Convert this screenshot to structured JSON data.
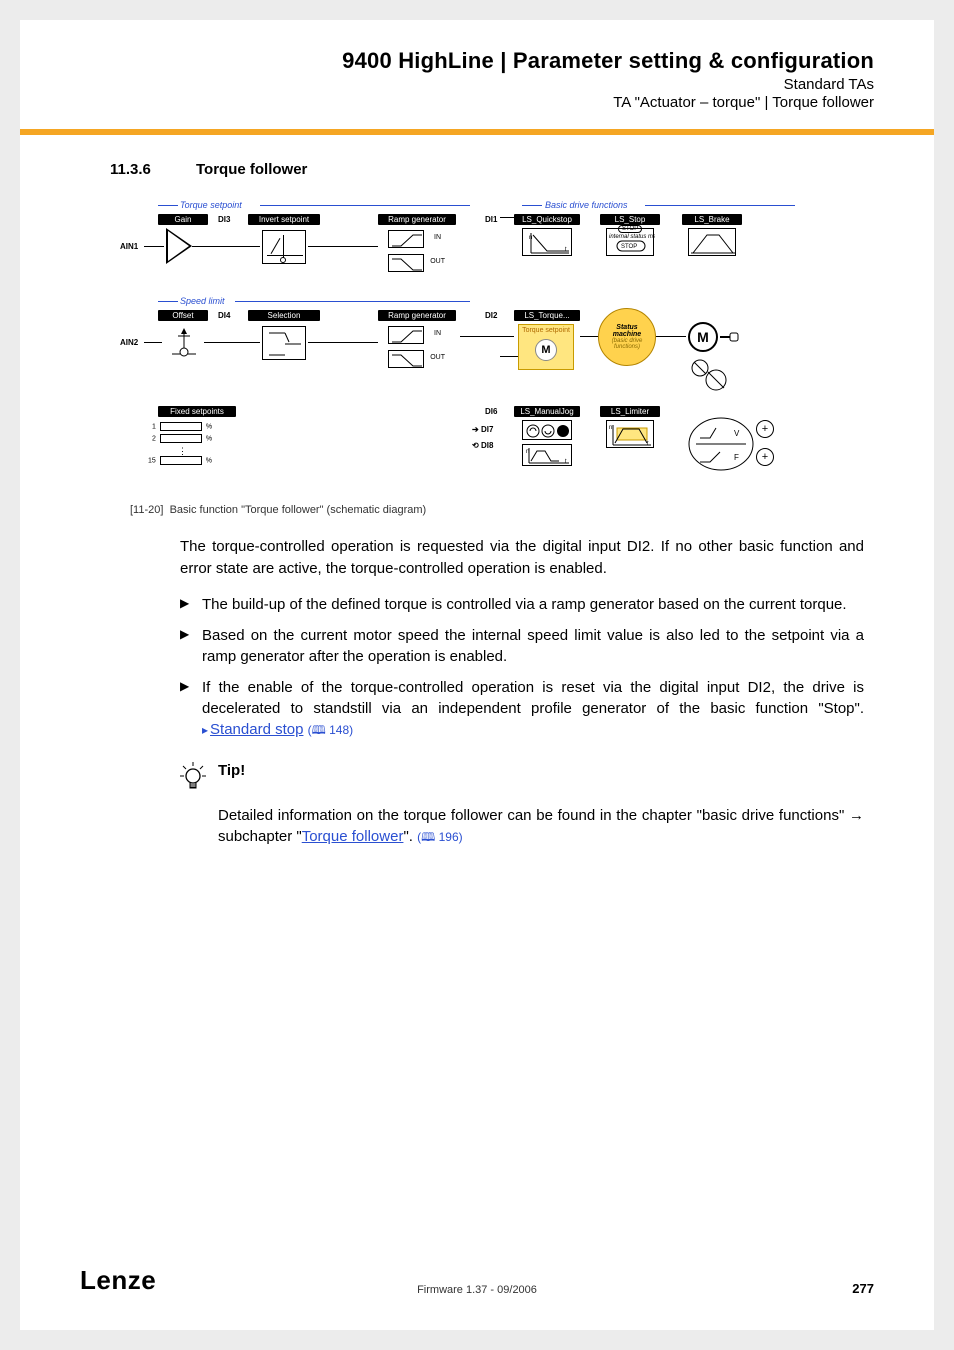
{
  "header": {
    "title": "9400 HighLine | Parameter setting & configuration",
    "sub1": "Standard TAs",
    "sub2": "TA \"Actuator – torque\" | Torque follower"
  },
  "section": {
    "number": "11.3.6",
    "title": "Torque follower"
  },
  "diagram": {
    "group1_label": "Torque setpoint",
    "group2_label": "Speed limit",
    "group3_label": "Basic drive functions",
    "gain": "Gain",
    "offset": "Offset",
    "di3": "DI3",
    "di4": "DI4",
    "invert": "Invert setpoint",
    "selection": "Selection",
    "ramp": "Ramp generator",
    "in": "IN",
    "out": "OUT",
    "ain1": "AIN1",
    "ain2": "AIN2",
    "di1": "DI1",
    "di2": "DI2",
    "di6": "DI6",
    "di7": "DI7",
    "di8": "DI8",
    "ls_quick": "LS_Quickstop",
    "ls_stop": "LS_Stop",
    "ls_brake": "LS_Brake",
    "ls_torque": "LS_Torque...",
    "ls_manual": "LS_ManualJog",
    "ls_limiter": "LS_Limiter",
    "torque_sp": "Torque setpoint",
    "status_m1": "Status",
    "status_m2": "machine",
    "status_m3": "(basic drive",
    "status_m4": "functions)",
    "internal": "internal status machine",
    "fixed": "Fixed setpoints",
    "pct": "%",
    "one": "1",
    "two": "2",
    "fifteen": "15",
    "stop": "STOP",
    "M": "M",
    "V": "V",
    "F": "F",
    "n": "n",
    "t": "t"
  },
  "caption": {
    "prefix": "[11-20]",
    "text": "Basic function \"Torque follower\" (schematic diagram)"
  },
  "para1": "The torque-controlled operation is requested via the digital input DI2. If no other basic function and error state are active, the torque-controlled operation is enabled.",
  "bullets": {
    "b1": "The build-up of the defined torque is controlled via a ramp generator based on the current torque.",
    "b2": "Based on the current motor speed the internal speed limit value is also led to the setpoint via a ramp generator after the operation is enabled.",
    "b3_pre": "If the enable of the torque-controlled operation is reset via the digital input DI2, the drive is decelerated to standstill via an independent profile generator of the basic function \"Stop\".  ",
    "b3_link": "Standard stop",
    "b3_ref": "148"
  },
  "tip": {
    "title": "Tip!",
    "body_pre": "Detailed information on the torque follower can be found in the chapter \"basic drive functions\" → subchapter \"",
    "body_link": "Torque follower",
    "body_post": "\". ",
    "ref": "196"
  },
  "footer": {
    "logo": "Lenze",
    "center": "Firmware 1.37 - 09/2006",
    "page": "277"
  }
}
